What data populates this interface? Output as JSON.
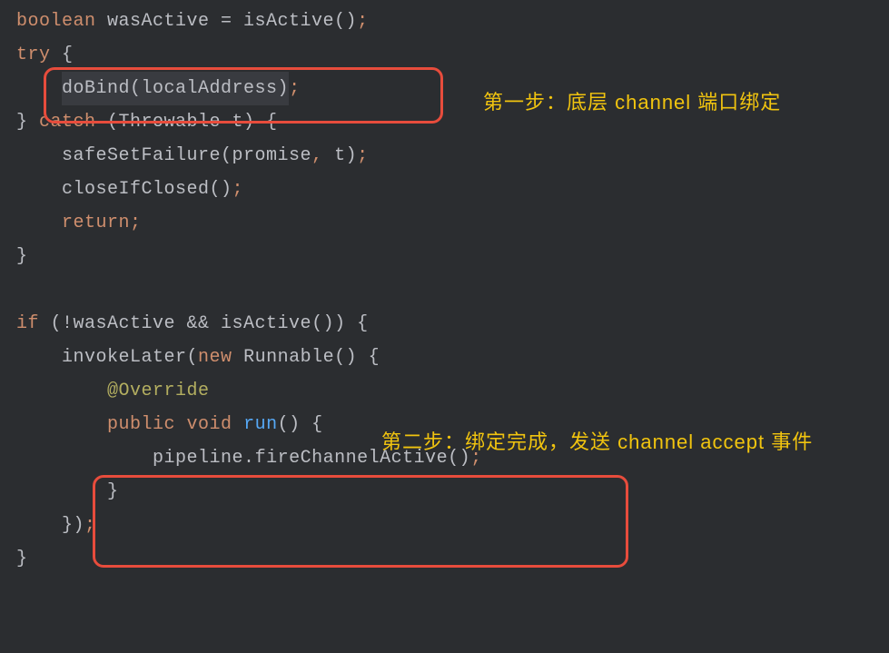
{
  "code": {
    "line1_kw1": "boolean",
    "line1_var": " wasActive = isActive()",
    "line1_semi": ";",
    "line2_kw": "try",
    "line2_brace": " {",
    "line3_indent": "    ",
    "line3_call": "doBind(localAddress)",
    "line3_semi": ";",
    "line4_brace1": "} ",
    "line4_kw": "catch",
    "line4_rest": " (Throwable t) {",
    "line5_indent": "    ",
    "line5_call": "safeSetFailure(promise",
    "line5_comma": ",",
    "line5_arg": " t)",
    "line5_semi": ";",
    "line6_indent": "    ",
    "line6_call": "closeIfClosed()",
    "line6_semi": ";",
    "line7_indent": "    ",
    "line7_kw": "return",
    "line7_semi": ";",
    "line8": "}",
    "line10_kw": "if",
    "line10_cond": " (!wasActive && isActive()) {",
    "line11_indent": "    ",
    "line11_call": "invokeLater(",
    "line11_kw": "new",
    "line11_rest": " Runnable() {",
    "line12_indent": "        ",
    "line12_anno": "@Override",
    "line13_indent": "        ",
    "line13_kw1": "public",
    "line13_sp1": " ",
    "line13_kw2": "void",
    "line13_sp2": " ",
    "line13_method": "run",
    "line13_rest": "() {",
    "line14_indent": "            ",
    "line14_obj": "pipeline.",
    "line14_call": "fireChannelActive()",
    "line14_semi": ";",
    "line15_indent": "        ",
    "line15_brace": "}",
    "line16_indent": "    ",
    "line16_rest": "})",
    "line16_semi": ";",
    "line17": "}"
  },
  "annotations": {
    "step1": "第一步：底层 channel 端口绑定",
    "step2": "第二步：绑定完成，发送 channel accept 事件"
  }
}
